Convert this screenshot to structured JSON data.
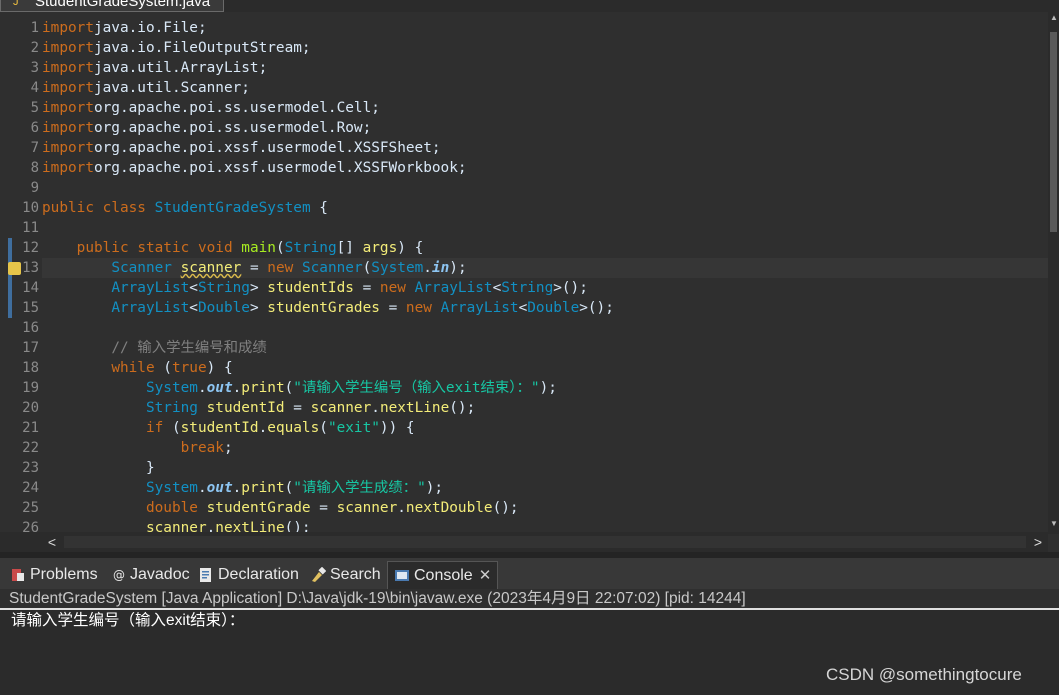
{
  "editor_tab": {
    "title": "StudentGradeSystem.java"
  },
  "lines": [
    {
      "n": "1",
      "tokens": [
        [
          "kw",
          "import"
        ],
        [
          "",
          "java.io.File;"
        ]
      ]
    },
    {
      "n": "2",
      "tokens": [
        [
          "kw",
          "import"
        ],
        [
          "",
          "java.io.FileOutputStream;"
        ]
      ]
    },
    {
      "n": "3",
      "tokens": [
        [
          "kw",
          "import"
        ],
        [
          "",
          "java.util.ArrayList;"
        ]
      ]
    },
    {
      "n": "4",
      "tokens": [
        [
          "kw",
          "import"
        ],
        [
          "",
          "java.util.Scanner;"
        ]
      ]
    },
    {
      "n": "5",
      "tokens": [
        [
          "kw",
          "import"
        ],
        [
          "",
          "org.apache.poi.ss.usermodel.Cell;"
        ]
      ]
    },
    {
      "n": "6",
      "tokens": [
        [
          "kw",
          "import"
        ],
        [
          "",
          "org.apache.poi.ss.usermodel.Row;"
        ]
      ]
    },
    {
      "n": "7",
      "tokens": [
        [
          "kw",
          "import"
        ],
        [
          "",
          "org.apache.poi.xssf.usermodel.XSSFSheet;"
        ]
      ]
    },
    {
      "n": "8",
      "tokens": [
        [
          "kw",
          "import"
        ],
        [
          "",
          "org.apache.poi.xssf.usermodel.XSSFWorkbook;"
        ]
      ]
    },
    {
      "n": "9",
      "tokens": []
    },
    {
      "n": "10",
      "tokens": [
        [
          "kw",
          "public"
        ],
        [
          "",
          " "
        ],
        [
          "kw",
          "class"
        ],
        [
          "",
          " "
        ],
        [
          "ty",
          "StudentGradeSystem"
        ],
        [
          "",
          " {"
        ]
      ]
    },
    {
      "n": "11",
      "tokens": []
    },
    {
      "n": "12",
      "tokens": [
        [
          "",
          "    "
        ],
        [
          "kw",
          "public"
        ],
        [
          "",
          " "
        ],
        [
          "kw",
          "static"
        ],
        [
          "",
          " "
        ],
        [
          "kw",
          "void"
        ],
        [
          "",
          " "
        ],
        [
          "fn",
          "main"
        ],
        [
          "",
          "("
        ],
        [
          "ty",
          "String"
        ],
        [
          "",
          "[] "
        ],
        [
          "vr",
          "args"
        ],
        [
          "",
          ") {"
        ]
      ]
    },
    {
      "n": "13",
      "tokens": [
        [
          "",
          "        "
        ],
        [
          "ty",
          "Scanner"
        ],
        [
          "",
          " "
        ],
        [
          "vr ul",
          "scanner"
        ],
        [
          "",
          " = "
        ],
        [
          "kw",
          "new"
        ],
        [
          "",
          " "
        ],
        [
          "ty",
          "Scanner"
        ],
        [
          "",
          "("
        ],
        [
          "ty",
          "System"
        ],
        [
          "",
          "."
        ],
        [
          "sf",
          "in"
        ],
        [
          "",
          ");"
        ]
      ]
    },
    {
      "n": "14",
      "tokens": [
        [
          "",
          "        "
        ],
        [
          "ty",
          "ArrayList"
        ],
        [
          "",
          "<"
        ],
        [
          "ty",
          "String"
        ],
        [
          "",
          "> "
        ],
        [
          "vr",
          "studentIds"
        ],
        [
          "",
          " = "
        ],
        [
          "kw",
          "new"
        ],
        [
          "",
          " "
        ],
        [
          "ty",
          "ArrayList"
        ],
        [
          "",
          "<"
        ],
        [
          "ty",
          "String"
        ],
        [
          "",
          ">();"
        ]
      ]
    },
    {
      "n": "15",
      "tokens": [
        [
          "",
          "        "
        ],
        [
          "ty",
          "ArrayList"
        ],
        [
          "",
          "<"
        ],
        [
          "ty",
          "Double"
        ],
        [
          "",
          "> "
        ],
        [
          "vr",
          "studentGrades"
        ],
        [
          "",
          " = "
        ],
        [
          "kw",
          "new"
        ],
        [
          "",
          " "
        ],
        [
          "ty",
          "ArrayList"
        ],
        [
          "",
          "<"
        ],
        [
          "ty",
          "Double"
        ],
        [
          "",
          ">();"
        ]
      ]
    },
    {
      "n": "16",
      "tokens": []
    },
    {
      "n": "17",
      "tokens": [
        [
          "",
          "        "
        ],
        [
          "cm",
          "// 输入学生编号和成绩"
        ]
      ]
    },
    {
      "n": "18",
      "tokens": [
        [
          "",
          "        "
        ],
        [
          "kw",
          "while"
        ],
        [
          "",
          " ("
        ],
        [
          "kw",
          "true"
        ],
        [
          "",
          ") {"
        ]
      ]
    },
    {
      "n": "19",
      "tokens": [
        [
          "",
          "            "
        ],
        [
          "ty",
          "System"
        ],
        [
          "",
          "."
        ],
        [
          "sf",
          "out"
        ],
        [
          "",
          "."
        ],
        [
          "vr",
          "print"
        ],
        [
          "",
          "("
        ],
        [
          "st",
          "\"请输入学生编号（输入exit结束）：\""
        ],
        [
          "",
          ");"
        ]
      ]
    },
    {
      "n": "20",
      "tokens": [
        [
          "",
          "            "
        ],
        [
          "ty",
          "String"
        ],
        [
          "",
          " "
        ],
        [
          "vr",
          "studentId"
        ],
        [
          "",
          " = "
        ],
        [
          "vr",
          "scanner"
        ],
        [
          "",
          "."
        ],
        [
          "vr",
          "nextLine"
        ],
        [
          "",
          "();"
        ]
      ]
    },
    {
      "n": "21",
      "tokens": [
        [
          "",
          "            "
        ],
        [
          "kw",
          "if"
        ],
        [
          "",
          " ("
        ],
        [
          "vr",
          "studentId"
        ],
        [
          "",
          "."
        ],
        [
          "vr",
          "equals"
        ],
        [
          "",
          "("
        ],
        [
          "st",
          "\"exit\""
        ],
        [
          "",
          ")) {"
        ]
      ]
    },
    {
      "n": "22",
      "tokens": [
        [
          "",
          "                "
        ],
        [
          "kw",
          "break"
        ],
        [
          "",
          ";"
        ]
      ]
    },
    {
      "n": "23",
      "tokens": [
        [
          "",
          "            }"
        ]
      ]
    },
    {
      "n": "24",
      "tokens": [
        [
          "",
          "            "
        ],
        [
          "ty",
          "System"
        ],
        [
          "",
          "."
        ],
        [
          "sf",
          "out"
        ],
        [
          "",
          "."
        ],
        [
          "vr",
          "print"
        ],
        [
          "",
          "("
        ],
        [
          "st",
          "\"请输入学生成绩：\""
        ],
        [
          "",
          ");"
        ]
      ]
    },
    {
      "n": "25",
      "tokens": [
        [
          "",
          "            "
        ],
        [
          "kw",
          "double"
        ],
        [
          "",
          " "
        ],
        [
          "vr",
          "studentGrade"
        ],
        [
          "",
          " = "
        ],
        [
          "vr",
          "scanner"
        ],
        [
          "",
          "."
        ],
        [
          "vr",
          "nextDouble"
        ],
        [
          "",
          "();"
        ]
      ]
    },
    {
      "n": "26",
      "tokens": [
        [
          "",
          "            "
        ],
        [
          "vr",
          "scanner"
        ],
        [
          "",
          "."
        ],
        [
          "vr",
          "nextLine"
        ],
        [
          "",
          "();"
        ]
      ]
    }
  ],
  "hscroll": {
    "left_arrow": "<",
    "right_arrow": ">"
  },
  "views": {
    "tabs": [
      {
        "label": "Problems",
        "icon": "problems-icon"
      },
      {
        "label": "Javadoc",
        "icon": "javadoc-icon"
      },
      {
        "label": "Declaration",
        "icon": "declaration-icon"
      },
      {
        "label": "Search",
        "icon": "search-icon"
      },
      {
        "label": "Console",
        "icon": "console-icon",
        "active": true
      }
    ],
    "close_glyph": "✕"
  },
  "console": {
    "header": "StudentGradeSystem [Java Application] D:\\Java\\jdk-19\\bin\\javaw.exe  (2023年4月9日 22:07:02) [pid: 14244]",
    "output": "请输入学生编号（输入exit结束）："
  },
  "watermark": "CSDN @somethingtocure",
  "colors": {
    "keyword": "#cc6c1d",
    "type": "#1290c3",
    "variable": "#f3ec79",
    "string": "#17c6a3",
    "comment": "#808080"
  }
}
